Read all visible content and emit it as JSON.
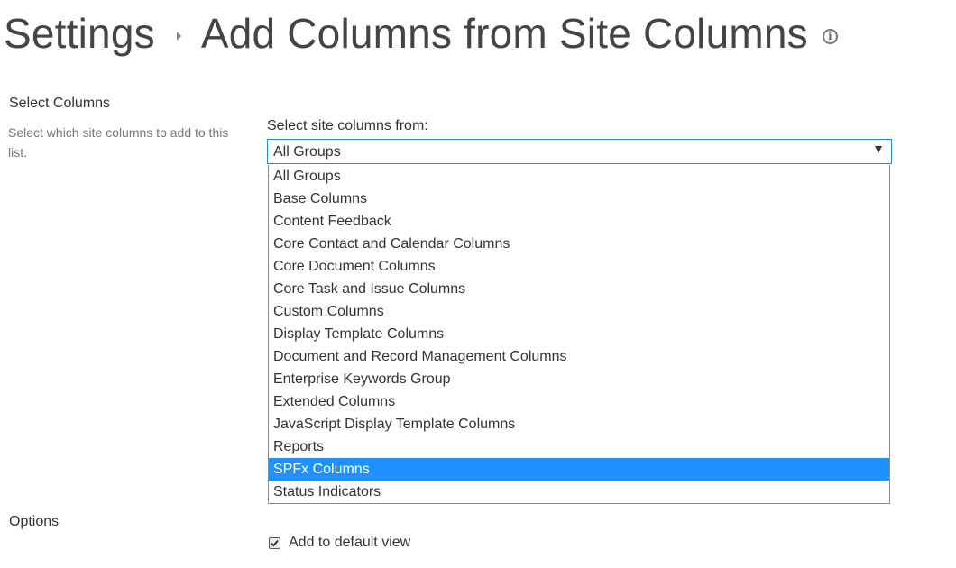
{
  "header": {
    "breadcrumb_root": "Settings",
    "page_title": "Add Columns from Site Columns",
    "info_icon": "info-circle-icon"
  },
  "select_columns_section": {
    "heading": "Select Columns",
    "description": "Select which site columns to add to this list.",
    "field_label": "Select site columns from:",
    "select": {
      "selected_value": "All Groups",
      "options": [
        "All Groups",
        "Base Columns",
        "Content Feedback",
        "Core Contact and Calendar Columns",
        "Core Document Columns",
        "Core Task and Issue Columns",
        "Custom Columns",
        "Display Template Columns",
        "Document and Record Management Columns",
        "Enterprise Keywords Group",
        "Extended Columns",
        "JavaScript Display Template Columns",
        "Reports",
        "SPFx Columns",
        "Status Indicators"
      ],
      "highlighted_option": "SPFx Columns"
    }
  },
  "options_section": {
    "heading": "Options",
    "add_to_default_view": {
      "label": "Add to default view",
      "checked": true
    }
  },
  "colors": {
    "highlight": "#1e90ff",
    "select_border": "#2188e6",
    "title_text": "#444444",
    "muted_text": "#777777"
  }
}
